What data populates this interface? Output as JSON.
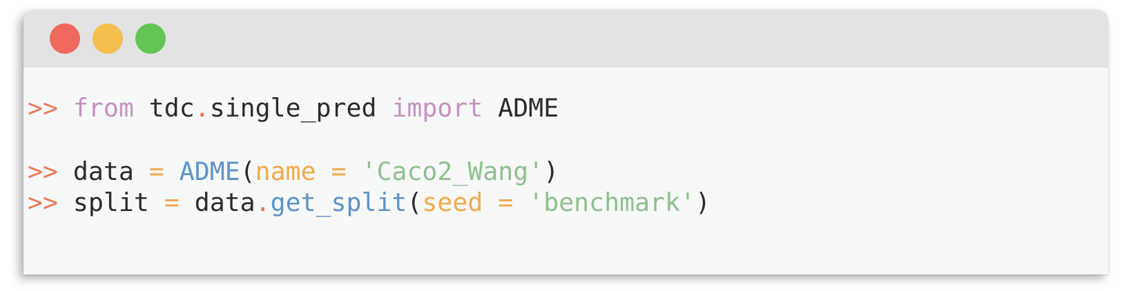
{
  "colors": {
    "prompt": "#ec7a57",
    "keyword": "#c690c3",
    "function": "#5c93c9",
    "parameter": "#f2aa4c",
    "string": "#8fc08f",
    "text": "#2b2b2b",
    "titlebar": "#e3e3e3",
    "code_background": "#f7f8f8",
    "close_button": "#ee6a5f",
    "minimize_button": "#f5be4f",
    "maximize_button": "#62c554"
  },
  "window_controls": {
    "close": "close-button",
    "minimize": "minimize-button",
    "maximize": "maximize-button"
  },
  "code_lines": [
    {
      "tokens": [
        {
          "type": "prompt",
          "text": ">>"
        },
        {
          "type": "default",
          "text": " "
        },
        {
          "type": "keyword",
          "text": "from"
        },
        {
          "type": "default",
          "text": " tdc"
        },
        {
          "type": "dot",
          "text": "."
        },
        {
          "type": "default",
          "text": "single_pred "
        },
        {
          "type": "keyword",
          "text": "import"
        },
        {
          "type": "default",
          "text": " ADME"
        }
      ]
    },
    {
      "tokens": [
        {
          "type": "prompt",
          "text": ">>"
        },
        {
          "type": "default",
          "text": " data "
        },
        {
          "type": "op",
          "text": "="
        },
        {
          "type": "default",
          "text": " "
        },
        {
          "type": "func",
          "text": "ADME"
        },
        {
          "type": "default",
          "text": "("
        },
        {
          "type": "param",
          "text": "name"
        },
        {
          "type": "default",
          "text": " "
        },
        {
          "type": "op",
          "text": "="
        },
        {
          "type": "default",
          "text": " "
        },
        {
          "type": "string",
          "text": "'Caco2_Wang'"
        },
        {
          "type": "default",
          "text": ")"
        }
      ]
    },
    {
      "tokens": [
        {
          "type": "prompt",
          "text": ">>"
        },
        {
          "type": "default",
          "text": " split "
        },
        {
          "type": "op",
          "text": "="
        },
        {
          "type": "default",
          "text": " data"
        },
        {
          "type": "dot",
          "text": "."
        },
        {
          "type": "func",
          "text": "get_split"
        },
        {
          "type": "default",
          "text": "("
        },
        {
          "type": "param",
          "text": "seed"
        },
        {
          "type": "default",
          "text": " "
        },
        {
          "type": "op",
          "text": "="
        },
        {
          "type": "default",
          "text": " "
        },
        {
          "type": "string",
          "text": "'benchmark'"
        },
        {
          "type": "default",
          "text": ")"
        }
      ]
    }
  ]
}
